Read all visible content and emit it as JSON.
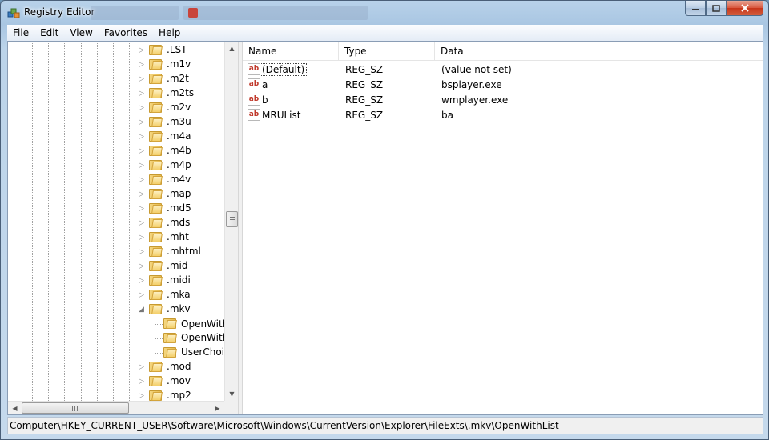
{
  "window": {
    "title": "Registry Editor"
  },
  "menu": [
    "File",
    "Edit",
    "View",
    "Favorites",
    "Help"
  ],
  "tree": {
    "items": [
      {
        "label": ".LST",
        "expander": "▷"
      },
      {
        "label": ".m1v",
        "expander": "▷"
      },
      {
        "label": ".m2t",
        "expander": "▷"
      },
      {
        "label": ".m2ts",
        "expander": "▷"
      },
      {
        "label": ".m2v",
        "expander": "▷"
      },
      {
        "label": ".m3u",
        "expander": "▷"
      },
      {
        "label": ".m4a",
        "expander": "▷"
      },
      {
        "label": ".m4b",
        "expander": "▷"
      },
      {
        "label": ".m4p",
        "expander": "▷"
      },
      {
        "label": ".m4v",
        "expander": "▷"
      },
      {
        "label": ".map",
        "expander": "▷"
      },
      {
        "label": ".md5",
        "expander": "▷"
      },
      {
        "label": ".mds",
        "expander": "▷"
      },
      {
        "label": ".mht",
        "expander": "▷"
      },
      {
        "label": ".mhtml",
        "expander": "▷"
      },
      {
        "label": ".mid",
        "expander": "▷"
      },
      {
        "label": ".midi",
        "expander": "▷"
      },
      {
        "label": ".mka",
        "expander": "▷"
      },
      {
        "label": ".mkv",
        "expander": "◢"
      },
      {
        "label": "OpenWith",
        "child": true,
        "selected": true
      },
      {
        "label": "OpenWith",
        "child": true
      },
      {
        "label": "UserChoic",
        "child": true
      },
      {
        "label": ".mod",
        "expander": "▷"
      },
      {
        "label": ".mov",
        "expander": "▷"
      },
      {
        "label": ".mp2",
        "expander": "▷"
      }
    ]
  },
  "list": {
    "columns": [
      "Name",
      "Type",
      "Data"
    ],
    "rows": [
      {
        "icon": "ab",
        "name": "(Default)",
        "type": "REG_SZ",
        "data": "(value not set)"
      },
      {
        "icon": "ab",
        "name": "a",
        "type": "REG_SZ",
        "data": "bsplayer.exe"
      },
      {
        "icon": "ab",
        "name": "b",
        "type": "REG_SZ",
        "data": "wmplayer.exe"
      },
      {
        "icon": "ab",
        "name": "MRUList",
        "type": "REG_SZ",
        "data": "ba"
      }
    ]
  },
  "status": {
    "path": "Computer\\HKEY_CURRENT_USER\\Software\\Microsoft\\Windows\\CurrentVersion\\Explorer\\FileExts\\.mkv\\OpenWithList"
  },
  "icons": {
    "app": "registry-editor-icon",
    "folder": "folder-icon",
    "string_value": "string-value-icon"
  },
  "colors": {
    "accent": "#c7351a",
    "selection_border": "#444444"
  }
}
